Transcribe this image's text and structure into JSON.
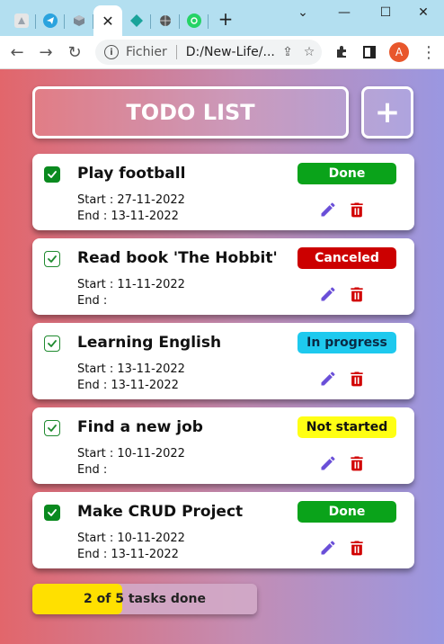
{
  "browser": {
    "tabs": [
      {
        "icon": "app-icon",
        "color": "#9aa3ad"
      },
      {
        "icon": "telegram-icon",
        "color": "#2aa3de"
      },
      {
        "icon": "cube-icon",
        "color": "#7b8792"
      },
      {
        "icon": "close-icon",
        "active": true
      },
      {
        "icon": "diamond-icon",
        "color": "#1aa39a"
      },
      {
        "icon": "globe-icon",
        "color": "#555555"
      },
      {
        "icon": "whatsapp-icon",
        "color": "#25d366"
      }
    ],
    "new_tab_label": "+",
    "address": {
      "scheme": "Fichier",
      "url": "D:/New-Life/..."
    },
    "avatar_letter": "A"
  },
  "app": {
    "title": "TODO LIST",
    "add_label": "+",
    "tasks": [
      {
        "title": "Play football",
        "checked": true,
        "status": "Done",
        "status_color": "#0aa31a",
        "status_text_color": "#ffffff",
        "start": "Start : 27-11-2022",
        "end": "End : 13-11-2022"
      },
      {
        "title": "Read book 'The Hobbit'",
        "checked": false,
        "status": "Canceled",
        "status_color": "#cc0000",
        "status_text_color": "#ffffff",
        "start": "Start : 11-11-2022",
        "end": "End :"
      },
      {
        "title": "Learning English",
        "checked": false,
        "status": "In progress",
        "status_color": "#1ec9ee",
        "status_text_color": "#0a2a44",
        "start": "Start : 13-11-2022",
        "end": "End : 13-11-2022"
      },
      {
        "title": "Find a new job",
        "checked": false,
        "status": "Not started",
        "status_color": "#ffff14",
        "status_text_color": "#111111",
        "start": "Start : 10-11-2022",
        "end": "End :"
      },
      {
        "title": "Make CRUD Project",
        "checked": true,
        "status": "Done",
        "status_color": "#0aa31a",
        "status_text_color": "#ffffff",
        "start": "Start : 10-11-2022",
        "end": "End : 13-11-2022"
      }
    ],
    "progress": {
      "label": "2 of 5 tasks done",
      "done": 2,
      "total": 5
    },
    "colors": {
      "edit": "#6a4fd8",
      "delete": "#d10000"
    }
  }
}
